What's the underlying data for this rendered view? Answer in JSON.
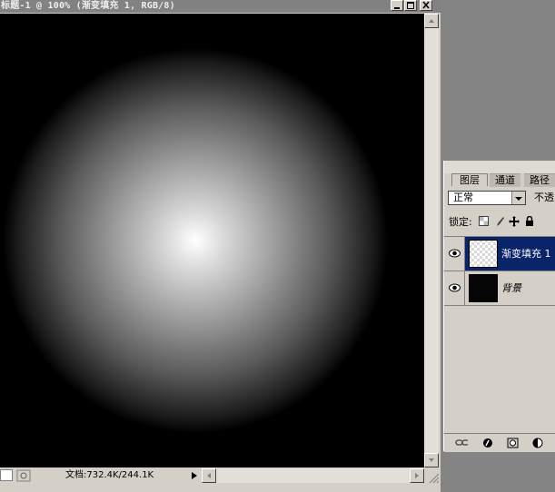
{
  "document": {
    "title": "标题-1 @ 100% (渐变填充 1, RGB/8)",
    "status_text": "文档:732.4K/244.1K"
  },
  "window_controls": [
    "minimize-icon",
    "maximize-icon",
    "close-icon"
  ],
  "canvas": {
    "fill": "radial-gradient",
    "gradient_colors": [
      "#ffffff",
      "#000000"
    ]
  },
  "layers_panel": {
    "tabs": [
      {
        "label": "图层",
        "active": true
      },
      {
        "label": "通道",
        "active": false
      },
      {
        "label": "路径",
        "active": false
      }
    ],
    "blend_mode": "正常",
    "opacity_label": "不透",
    "lock_label": "锁定:",
    "lock_icons": [
      "lock-transparency-icon",
      "lock-brush-icon",
      "lock-move-icon",
      "lock-all-icon"
    ],
    "layers": [
      {
        "name": "渐变填充 1",
        "selected": true,
        "visible": true
      },
      {
        "name": "背景",
        "selected": false,
        "visible": true,
        "italic": true
      }
    ],
    "footer_icons": [
      "link-icon",
      "layer-style-icon",
      "layer-mask-icon",
      "adjustment-layer-icon"
    ]
  },
  "colors": {
    "selection": "#0a246a",
    "chrome": "#d4d0c8",
    "titlebar": "#828282",
    "workspace": "#848484"
  }
}
